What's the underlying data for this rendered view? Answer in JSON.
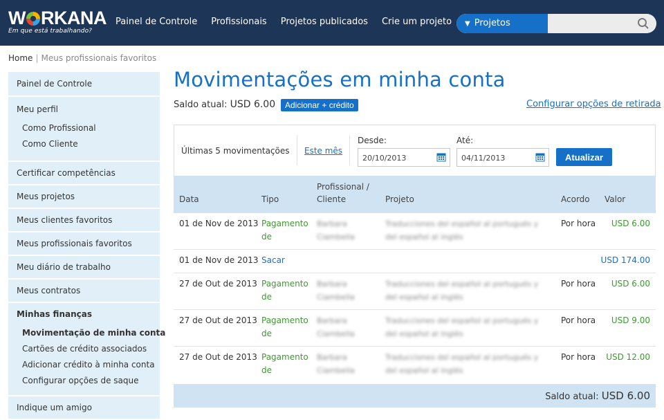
{
  "header": {
    "logo_text": "WORKANA",
    "logo_tagline": "Em que está trabalhando?",
    "nav": [
      "Painel de Controle",
      "Profissionais",
      "Projetos publicados",
      "Crie um projeto"
    ],
    "search_dropdown": "Projetos",
    "search_placeholder": ""
  },
  "breadcrumb": {
    "home": "Home",
    "separator": "|",
    "current": "Meus profissionais favoritos"
  },
  "sidebar": {
    "painel": "Painel de Controle",
    "perfil": "Meu perfil",
    "perfil_subs": [
      "Como Profissional",
      "Como Cliente"
    ],
    "items": [
      "Certificar competências",
      "Meus projetos",
      "Meus clientes favoritos",
      "Meus profissionais favoritos",
      "Meu diário de trabalho",
      "Meus contratos"
    ],
    "financas": "Minhas finanças",
    "financas_subs": [
      "Movimentação de minha conta",
      "Cartões de crédito associados",
      "Adicionar crédito à minha conta",
      "Configurar opções de saque"
    ],
    "indique": "Indique um amigo"
  },
  "main": {
    "title": "Movimentações em minha conta",
    "balance_label": "Saldo atual:",
    "balance_amount": "USD 6.00",
    "add_credit": "Adicionar + crédito",
    "config_link": "Configurar opções de retirada"
  },
  "filter": {
    "last": "Últimas 5 movimentações",
    "this_month": "Este mês",
    "from_label": "Desde:",
    "from_value": "20/10/2013",
    "to_label": "Até:",
    "to_value": "04/11/2013",
    "update_btn": "Atualizar"
  },
  "table": {
    "headers": {
      "data": "Data",
      "tipo": "Tipo",
      "prof1": "Profissional /",
      "prof2": "Cliente",
      "projeto": "Projeto",
      "acordo": "Acordo",
      "valor": "Valor"
    },
    "rows": [
      {
        "date": "01 de Nov de 2013",
        "tipo1": "Pagamento",
        "tipo2": "de",
        "prof1": "Barbara",
        "prof2": "Ciambella",
        "proj1": "Traducciones del español al portugués y",
        "proj2": "del español al inglés",
        "acordo": "Por hora",
        "valor": "USD 6.00"
      },
      {
        "date": "01 de Nov de 2013",
        "tipo1": "Sacar",
        "tipo2": "",
        "prof1": "",
        "prof2": "",
        "proj1": "",
        "proj2": "",
        "acordo": "",
        "valor": "USD 174.00"
      },
      {
        "date": "27 de Out de 2013",
        "tipo1": "Pagamento",
        "tipo2": "de",
        "prof1": "Barbara",
        "prof2": "Ciambella",
        "proj1": "Traducciones del español al portugués y",
        "proj2": "del español al inglés",
        "acordo": "Por hora",
        "valor": "USD 6.00"
      },
      {
        "date": "27 de Out de 2013",
        "tipo1": "Pagamento",
        "tipo2": "de",
        "prof1": "Barbara",
        "prof2": "Ciambella",
        "proj1": "Traducciones del español al portugués y",
        "proj2": "del español al inglés",
        "acordo": "Por hora",
        "valor": "USD 9.00"
      },
      {
        "date": "27 de Out de 2013",
        "tipo1": "Pagamento",
        "tipo2": "de",
        "prof1": "Barbara",
        "prof2": "Ciambella",
        "proj1": "Traducciones del español al portugués y",
        "proj2": "del español al inglés",
        "acordo": "Por hora",
        "valor": "USD 12.00"
      }
    ],
    "footer_label": "Saldo atual:",
    "footer_amount": "USD 6.00"
  },
  "colors": {
    "nav_bg": "#1d3556",
    "accent": "#1670c7",
    "sidebar_bg": "#e1f0f8",
    "table_head_bg": "#cfe3f2",
    "green": "#3c9a2f"
  }
}
